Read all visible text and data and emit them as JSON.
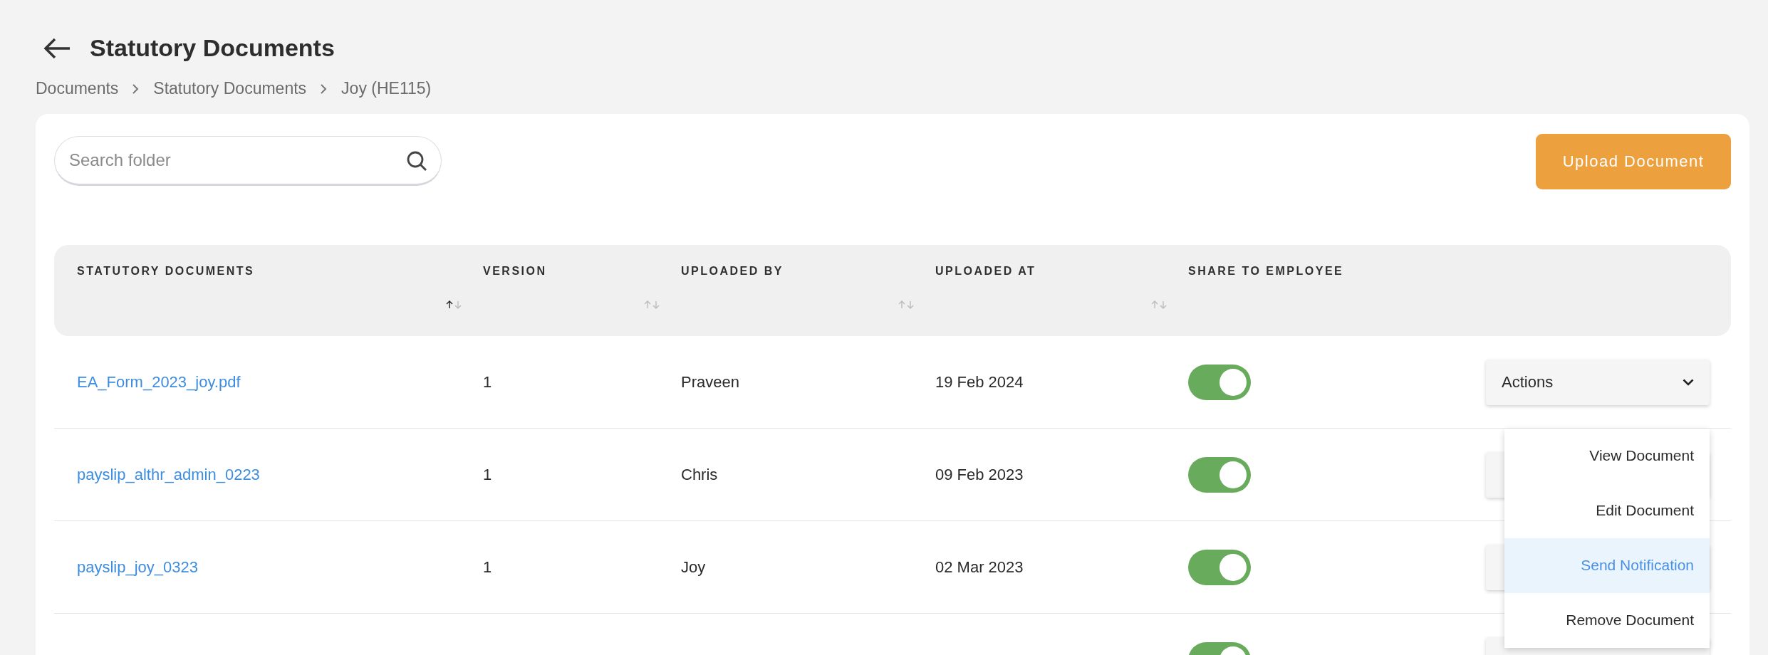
{
  "header": {
    "title": "Statutory Documents"
  },
  "breadcrumb": [
    "Documents",
    "Statutory Documents",
    "Joy (HE115)"
  ],
  "search": {
    "placeholder": "Search folder"
  },
  "upload_button": "Upload Document",
  "table": {
    "columns": [
      {
        "label": "STATUTORY DOCUMENTS",
        "sorted_ascending": true
      },
      {
        "label": "VERSION",
        "sorted_ascending": false
      },
      {
        "label": "UPLOADED BY",
        "sorted_ascending": false
      },
      {
        "label": "UPLOADED AT",
        "sorted_ascending": false
      },
      {
        "label": "SHARE TO EMPLOYEE"
      }
    ],
    "rows": [
      {
        "name": "EA_Form_2023_joy.pdf",
        "version": "1",
        "uploaded_by": "Praveen",
        "uploaded_at": "19 Feb 2024",
        "shared": true,
        "actions": "Actions"
      },
      {
        "name": "payslip_althr_admin_0223",
        "version": "1",
        "uploaded_by": "Chris",
        "uploaded_at": "09 Feb 2023",
        "shared": true
      },
      {
        "name": "payslip_joy_0323",
        "version": "1",
        "uploaded_by": "Joy",
        "uploaded_at": "02 Mar 2023",
        "shared": true
      },
      {
        "shared": true
      }
    ]
  },
  "actions_menu": {
    "items": [
      {
        "label": "View Document",
        "selected": false
      },
      {
        "label": "Edit Document",
        "selected": false
      },
      {
        "label": "Send Notification",
        "selected": true
      },
      {
        "label": "Remove Document",
        "selected": false
      }
    ]
  }
}
